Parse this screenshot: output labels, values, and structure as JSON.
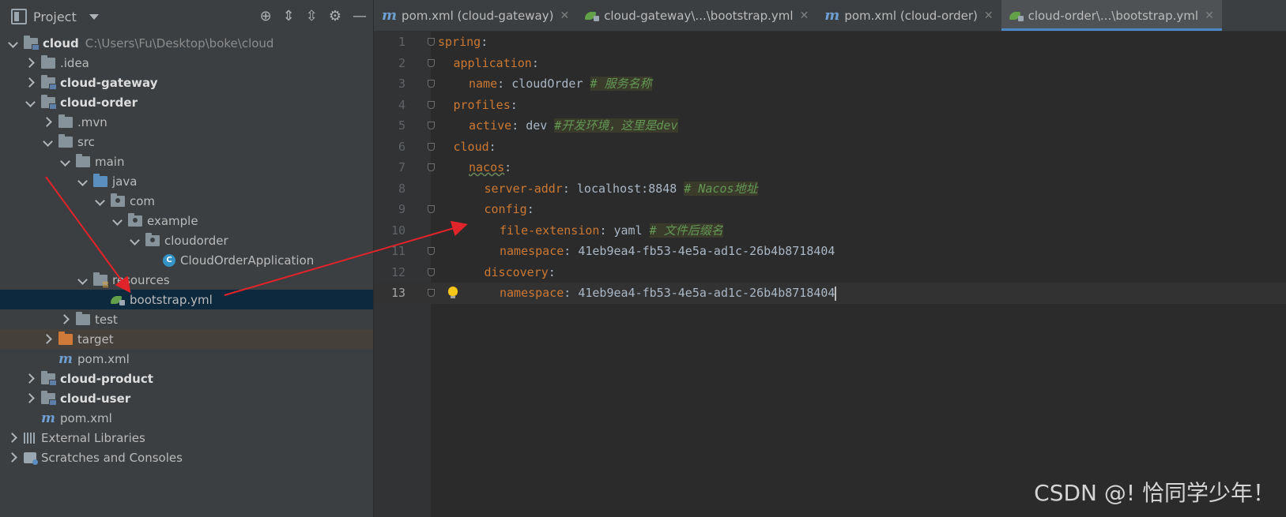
{
  "project_panel": {
    "title": "Project",
    "tool_icons": [
      "crosshair-icon",
      "expand-all-icon",
      "collapse-all-icon",
      "gear-icon",
      "minimize-icon"
    ]
  },
  "tree": [
    {
      "label": "cloud",
      "path": "C:\\Users\\Fu\\Desktop\\boke\\cloud",
      "bold": true,
      "indent": 0,
      "arrow": "d",
      "icon": "module"
    },
    {
      "label": ".idea",
      "indent": 1,
      "arrow": "r",
      "icon": "folder"
    },
    {
      "label": "cloud-gateway",
      "bold": true,
      "indent": 1,
      "arrow": "r",
      "icon": "module"
    },
    {
      "label": "cloud-order",
      "bold": true,
      "indent": 1,
      "arrow": "d",
      "icon": "module"
    },
    {
      "label": ".mvn",
      "indent": 2,
      "arrow": "r",
      "icon": "folder"
    },
    {
      "label": "src",
      "indent": 2,
      "arrow": "d",
      "icon": "folder"
    },
    {
      "label": "main",
      "indent": 3,
      "arrow": "d",
      "icon": "folder"
    },
    {
      "label": "java",
      "indent": 4,
      "arrow": "d",
      "icon": "blue"
    },
    {
      "label": "com",
      "indent": 5,
      "arrow": "d",
      "icon": "pkg"
    },
    {
      "label": "example",
      "indent": 6,
      "arrow": "d",
      "icon": "pkg"
    },
    {
      "label": "cloudorder",
      "indent": 7,
      "arrow": "d",
      "icon": "pkg"
    },
    {
      "label": "CloudOrderApplication",
      "indent": 8,
      "arrow": "",
      "icon": "class"
    },
    {
      "label": "resources",
      "indent": 4,
      "arrow": "d",
      "icon": "res"
    },
    {
      "label": "bootstrap.yml",
      "indent": 5,
      "arrow": "",
      "icon": "spring",
      "selected": true
    },
    {
      "label": "test",
      "indent": 3,
      "arrow": "r",
      "icon": "folder"
    },
    {
      "label": "target",
      "indent": 2,
      "arrow": "r",
      "icon": "orange",
      "excluded": true
    },
    {
      "label": "pom.xml",
      "indent": 2,
      "arrow": "",
      "icon": "m"
    },
    {
      "label": "cloud-product",
      "bold": true,
      "indent": 1,
      "arrow": "r",
      "icon": "module"
    },
    {
      "label": "cloud-user",
      "bold": true,
      "indent": 1,
      "arrow": "r",
      "icon": "module"
    },
    {
      "label": "pom.xml",
      "indent": 1,
      "arrow": "",
      "icon": "m"
    },
    {
      "label": "External Libraries",
      "indent": 0,
      "arrow": "r",
      "icon": "lib"
    },
    {
      "label": "Scratches and Consoles",
      "indent": 0,
      "arrow": "r",
      "icon": "scratch"
    }
  ],
  "tabs": [
    {
      "label": "pom.xml (cloud-gateway)",
      "icon": "m",
      "active": false
    },
    {
      "label": "cloud-gateway\\...\\bootstrap.yml",
      "icon": "spring",
      "active": false
    },
    {
      "label": "pom.xml (cloud-order)",
      "icon": "m",
      "active": false
    },
    {
      "label": "cloud-order\\...\\bootstrap.yml",
      "icon": "spring",
      "active": true
    }
  ],
  "code_lines": [
    {
      "n": "1",
      "indent": 0,
      "key": "spring",
      "sep": ":",
      "value": "",
      "comment": "",
      "fold": true
    },
    {
      "n": "2",
      "indent": 1,
      "key": "application",
      "sep": ":",
      "value": "",
      "comment": "",
      "fold": true
    },
    {
      "n": "3",
      "indent": 2,
      "key": "name",
      "sep": ": ",
      "value": "cloudOrder ",
      "comment": "# 服务名称",
      "fold": true
    },
    {
      "n": "4",
      "indent": 1,
      "key": "profiles",
      "sep": ":",
      "value": "",
      "comment": "",
      "fold": true
    },
    {
      "n": "5",
      "indent": 2,
      "key": "active",
      "sep": ": ",
      "value": "dev ",
      "comment": "#开发环境，这里是dev",
      "fold": true
    },
    {
      "n": "6",
      "indent": 1,
      "key": "cloud",
      "sep": ":",
      "value": "",
      "comment": "",
      "fold": true
    },
    {
      "n": "7",
      "indent": 2,
      "key": "nacos",
      "sep": ":",
      "value": "",
      "comment": "",
      "fold": true,
      "squig": true
    },
    {
      "n": "8",
      "indent": 3,
      "key": "server-addr",
      "sep": ": ",
      "value": "localhost:8848 ",
      "comment": "# Nacos地址",
      "fold": false
    },
    {
      "n": "9",
      "indent": 3,
      "key": "config",
      "sep": ":",
      "value": "",
      "comment": "",
      "fold": true
    },
    {
      "n": "10",
      "indent": 4,
      "key": "file-extension",
      "sep": ": ",
      "value": "yaml ",
      "comment": "# 文件后缀名",
      "fold": false
    },
    {
      "n": "11",
      "indent": 4,
      "key": "namespace",
      "sep": ": ",
      "value": "41eb9ea4-fb53-4e5a-ad1c-26b4b8718404",
      "comment": "",
      "fold": true
    },
    {
      "n": "12",
      "indent": 3,
      "key": "discovery",
      "sep": ":",
      "value": "",
      "comment": "",
      "fold": true
    },
    {
      "n": "13",
      "indent": 4,
      "key": "namespace",
      "sep": ": ",
      "value": "41eb9ea4-fb53-4e5a-ad1c-26b4b8718404",
      "comment": "",
      "fold": true,
      "current": true
    }
  ],
  "watermark": "CSDN @! 恰同学少年！",
  "colors": {
    "keyword": "#cc7832",
    "comment": "#629755",
    "annotation_arrow": "#e0242a",
    "selection": "#0d293e"
  }
}
